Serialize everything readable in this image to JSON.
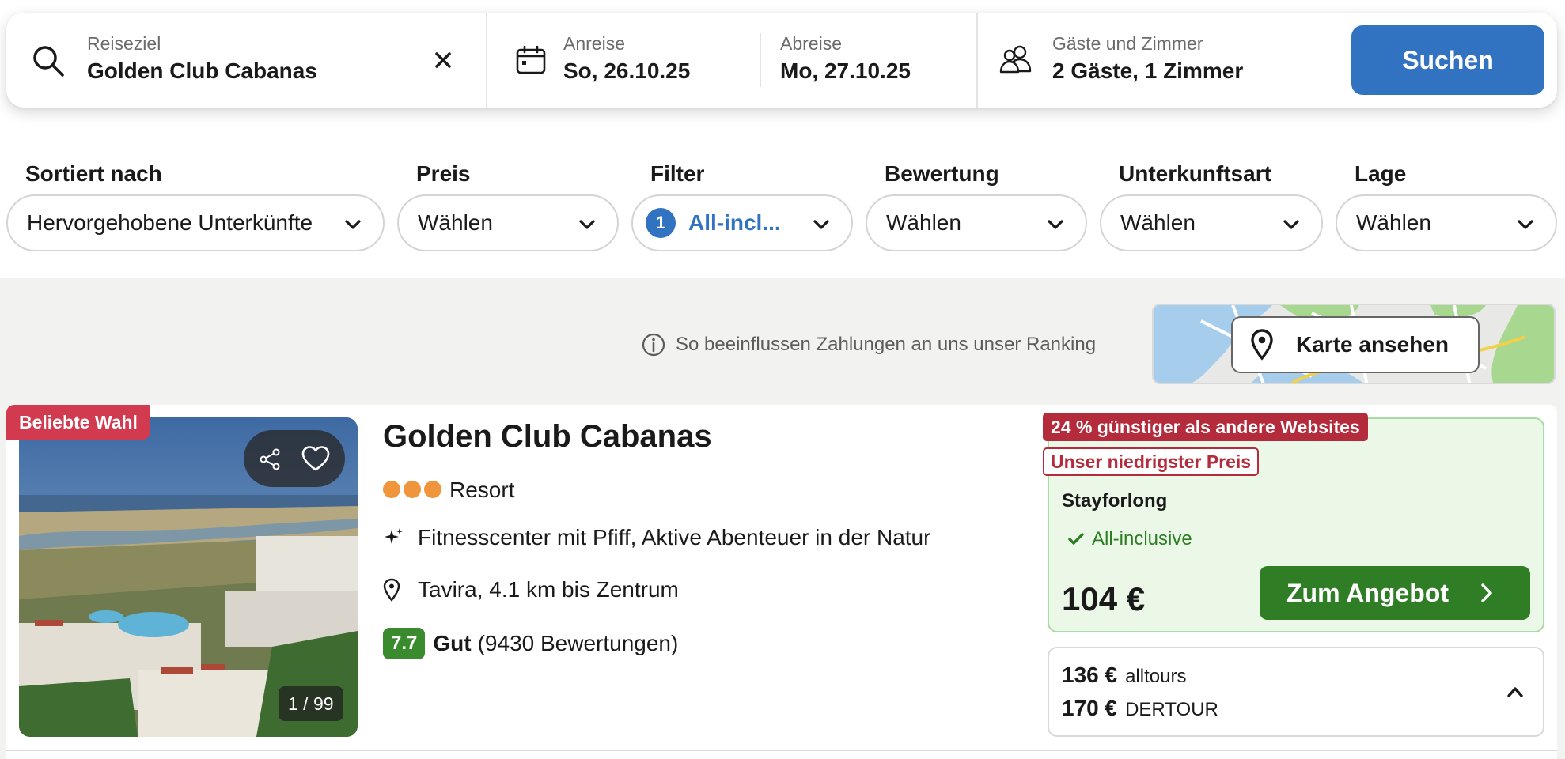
{
  "search": {
    "destination_label": "Reiseziel",
    "destination_value": "Golden Club Cabanas",
    "checkin_label": "Anreise",
    "checkin_value": "So, 26.10.25",
    "checkout_label": "Abreise",
    "checkout_value": "Mo, 27.10.25",
    "guests_label": "Gäste und Zimmer",
    "guests_value": "2 Gäste, 1 Zimmer",
    "search_button": "Suchen"
  },
  "filters": {
    "sort": {
      "label": "Sortiert nach",
      "value": "Hervorgehobene Unterkünfte"
    },
    "price": {
      "label": "Preis",
      "value": "Wählen"
    },
    "filter": {
      "label": "Filter",
      "count": "1",
      "value": "All-incl..."
    },
    "rating": {
      "label": "Bewertung",
      "value": "Wählen"
    },
    "accommodation": {
      "label": "Unterkunftsart",
      "value": "Wählen"
    },
    "location": {
      "label": "Lage",
      "value": "Wählen"
    }
  },
  "results": {
    "ranking_info": "So beeinflussen Zahlungen an uns unser Ranking",
    "map_button": "Karte ansehen"
  },
  "hotel": {
    "badge": "Beliebte Wahl",
    "photo_counter": "1 / 99",
    "name": "Golden Club Cabanas",
    "star_count": 3,
    "type": "Resort",
    "features": "Fitnesscenter mit Pfiff, Aktive Abenteuer in der Natur",
    "location": "Tavira, 4.1 km bis Zentrum",
    "rating_score": "7.7",
    "rating_word": "Gut",
    "rating_count": "(9430 Bewertungen)"
  },
  "offer": {
    "deal_badge": "24 % günstiger als andere Websites",
    "lowest_badge": "Unser niedrigster Preis",
    "provider": "Stayforlong",
    "board": "All-inclusive",
    "price": "104 €",
    "cta": "Zum Angebot",
    "alternatives": [
      {
        "price": "136 €",
        "provider": "alltours"
      },
      {
        "price": "170 €",
        "provider": "DERTOUR"
      }
    ]
  },
  "colors": {
    "accent_blue": "#3172c1",
    "deal_green": "#2f7d24",
    "badge_red": "#b42b3c",
    "popular_red": "#d23a4f",
    "star_orange": "#f0953c"
  },
  "icons": [
    "search-icon",
    "close-icon",
    "calendar-icon",
    "guests-icon",
    "chevron-down-icon",
    "info-icon",
    "map-pin-icon",
    "share-icon",
    "heart-icon",
    "sparkle-icon",
    "check-icon",
    "chevron-right-icon",
    "chevron-up-icon"
  ]
}
